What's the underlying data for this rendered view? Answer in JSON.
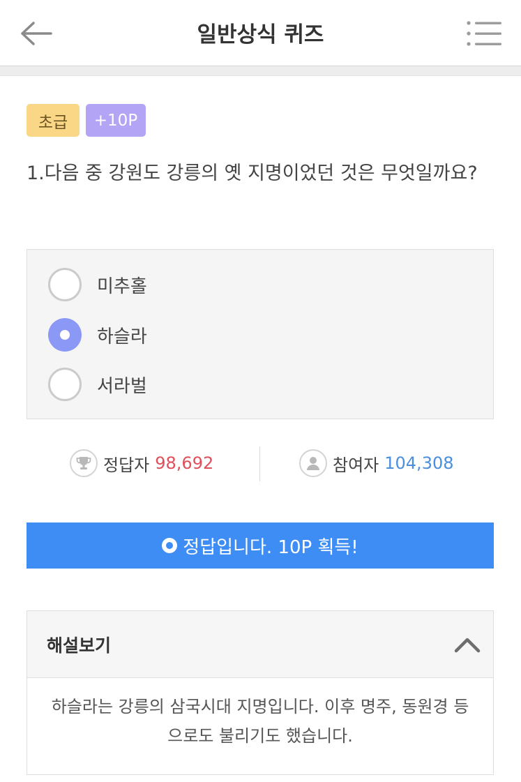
{
  "header": {
    "title": "일반상식 퀴즈",
    "back_icon": "arrow-left-icon",
    "menu_icon": "list-menu-icon"
  },
  "badges": {
    "level": "초급",
    "points": "+10P"
  },
  "question": {
    "text": "1.다음 중 강원도 강릉의 옛 지명이었던 것은 무엇일까요?"
  },
  "options": [
    {
      "label": "미추홀",
      "selected": false
    },
    {
      "label": "하슬라",
      "selected": true
    },
    {
      "label": "서라벌",
      "selected": false
    }
  ],
  "stats": {
    "correct_label": "정답자",
    "correct_value": "98,692",
    "correct_icon": "trophy-icon",
    "participants_label": "참여자",
    "participants_value": "104,308",
    "participants_icon": "person-icon"
  },
  "result": {
    "text": "정답입니다. 10P 획득!"
  },
  "explanation": {
    "title": "해설보기",
    "body": "하슬라는 강릉의 삼국시대 지명입니다. 이후 명주, 동원경 등으로도 불리기도 했습니다.",
    "toggle_icon": "chevron-up-icon"
  },
  "colors": {
    "accent_blue": "#3e8df5",
    "radio_selected": "#8c98f5",
    "correct_count": "#e0505a",
    "participant_count": "#4a8fdd",
    "badge_level_bg": "#f9d787",
    "badge_points_bg": "#b4a4f6"
  }
}
